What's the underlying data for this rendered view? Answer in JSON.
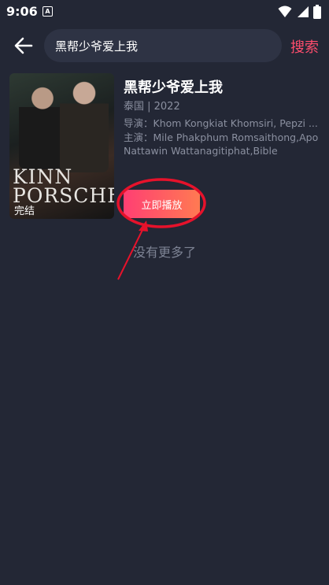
{
  "status_bar": {
    "time": "9:06",
    "notification_letter": "A"
  },
  "search": {
    "value": "黑帮少爷爱上我",
    "button_label": "搜索"
  },
  "result": {
    "title": "黑帮少爷爱上我",
    "meta": "泰国 | 2022",
    "director": "导演：Khom Kongkiat Khomsiri, Pepzi ...",
    "cast": "主演：Mile Phakphum Romsaithong,Apo Nattawin Wattanagitiphat,Bible",
    "poster_title": "KINN PORSCHE",
    "poster_badge": "完结",
    "play_label": "立即播放"
  },
  "footer_text": "没有更多了",
  "colors": {
    "background": "#232735",
    "accent": "#ff4d6d",
    "annotation": "#e6122b"
  },
  "icons": [
    "back-arrow-icon",
    "wifi-icon",
    "signal-icon",
    "battery-icon"
  ]
}
